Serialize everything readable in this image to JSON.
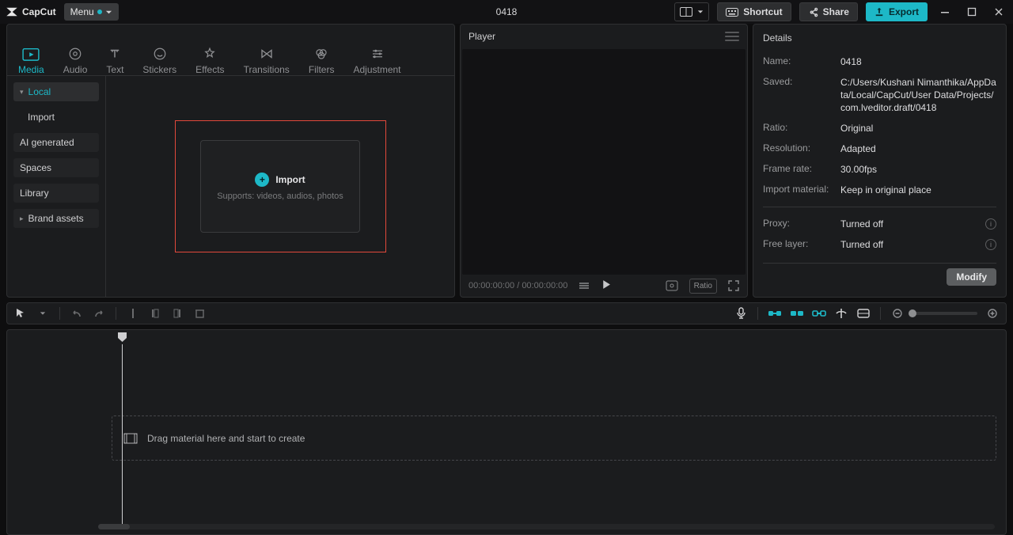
{
  "brand": "CapCut",
  "titlebar": {
    "menu_label": "Menu",
    "project_name": "0418",
    "shortcut_label": "Shortcut",
    "share_label": "Share",
    "export_label": "Export"
  },
  "tabs": [
    {
      "label": "Media",
      "icon": "media-icon"
    },
    {
      "label": "Audio",
      "icon": "audio-icon"
    },
    {
      "label": "Text",
      "icon": "text-icon"
    },
    {
      "label": "Stickers",
      "icon": "stickers-icon"
    },
    {
      "label": "Effects",
      "icon": "effects-icon"
    },
    {
      "label": "Transitions",
      "icon": "transitions-icon"
    },
    {
      "label": "Filters",
      "icon": "filters-icon"
    },
    {
      "label": "Adjustment",
      "icon": "adjustment-icon"
    }
  ],
  "sidebar": {
    "items": [
      {
        "label": "Local",
        "active": true,
        "expandable": true
      },
      {
        "label": "Import",
        "style": "plain"
      },
      {
        "label": "AI generated",
        "style": "box"
      },
      {
        "label": "Spaces",
        "style": "box"
      },
      {
        "label": "Library",
        "style": "box"
      },
      {
        "label": "Brand assets",
        "style": "box",
        "expandable": true
      }
    ]
  },
  "import_zone": {
    "title": "Import",
    "subtitle": "Supports: videos, audios, photos"
  },
  "player": {
    "title": "Player",
    "time_current": "00:00:00:00",
    "time_total": "00:00:00:00",
    "ratio_label": "Ratio"
  },
  "details": {
    "title": "Details",
    "rows": [
      {
        "k": "Name:",
        "v": "0418"
      },
      {
        "k": "Saved:",
        "v": "C:/Users/Kushani Nimanthika/AppData/Local/CapCut/User Data/Projects/com.lveditor.draft/0418"
      },
      {
        "k": "Ratio:",
        "v": "Original"
      },
      {
        "k": "Resolution:",
        "v": "Adapted"
      },
      {
        "k": "Frame rate:",
        "v": "30.00fps"
      },
      {
        "k": "Import material:",
        "v": "Keep in original place"
      }
    ],
    "section2": [
      {
        "k": "Proxy:",
        "v": "Turned off"
      },
      {
        "k": "Free layer:",
        "v": "Turned off"
      }
    ],
    "modify_label": "Modify"
  },
  "timeline": {
    "drop_text": "Drag material here and start to create"
  }
}
